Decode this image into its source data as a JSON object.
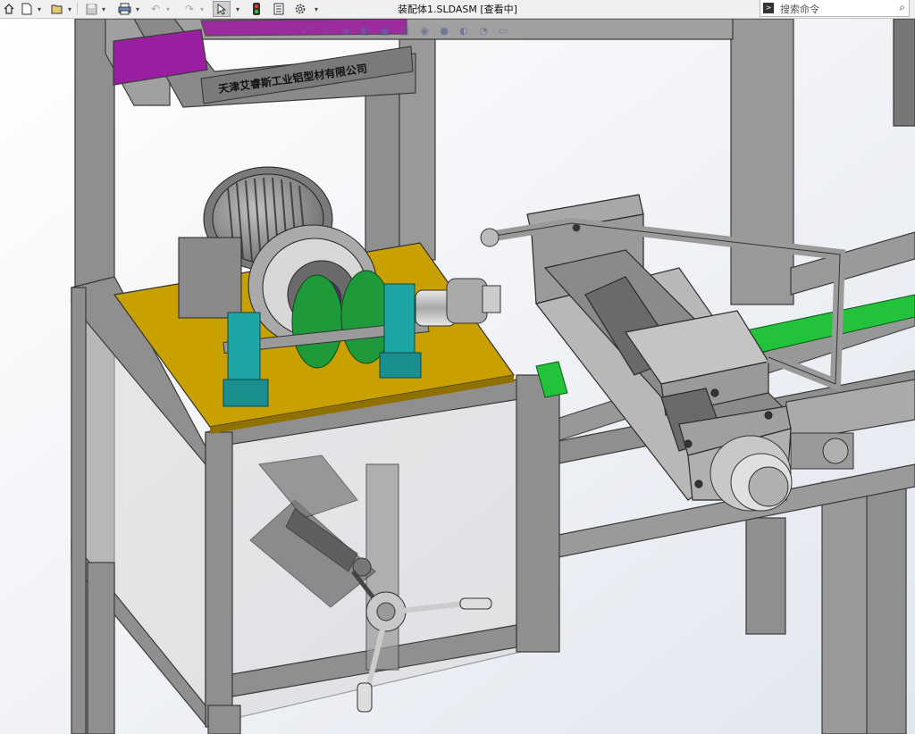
{
  "window": {
    "title": "装配体1.SLDASM [查看中]"
  },
  "search": {
    "placeholder": "搜索命令"
  },
  "model": {
    "label_plate_text": "天津艾睿斯工业铝型材有限公司"
  },
  "colors": {
    "frame": "#8f8f8f",
    "plate": "#c8a000",
    "teal": "#1fa5a5",
    "green_disc": "#1f9a3a",
    "purple": "#9a0f9f",
    "green_rail": "#22c23a"
  },
  "toolbar": {
    "icons": [
      "home-icon",
      "new-document-icon",
      "open-icon",
      "save-icon",
      "print-icon",
      "undo-icon",
      "redo-icon",
      "select-icon",
      "rebuild-icon",
      "file-properties-icon",
      "options-icon"
    ]
  },
  "hud": {
    "icons": [
      "zoom-to-fit-icon",
      "zoom-area-icon",
      "previous-view-icon",
      "section-view-icon",
      "view-orientation-icon",
      "display-style-icon",
      "hide-show-icon",
      "edit-appearance-icon",
      "apply-scene-icon",
      "view-settings-icon",
      "display-pane-icon"
    ]
  }
}
